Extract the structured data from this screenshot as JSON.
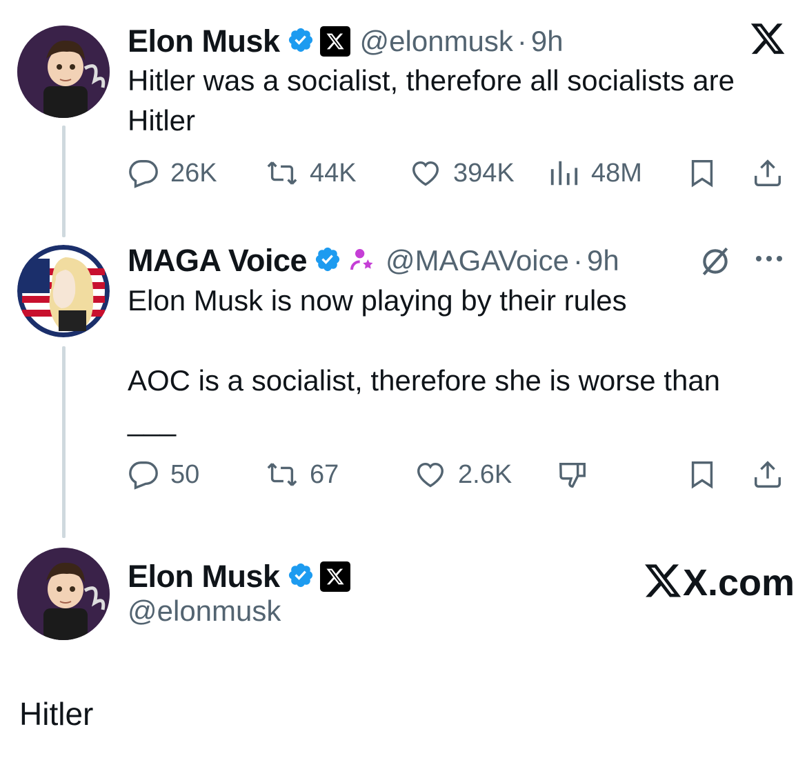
{
  "tweet1": {
    "name": "Elon Musk",
    "handle": "@elonmusk",
    "time": "9h",
    "text_line1": "Hitler was a socialist, therefore all socialists are",
    "text_line2": "Hitler",
    "replies": "26K",
    "retweets": "44K",
    "likes": "394K",
    "views": "48M",
    "icons": [
      "verified-badge-icon",
      "x-affiliate-icon",
      "x-logo-icon",
      "reply-icon",
      "retweet-icon",
      "like-icon",
      "views-icon",
      "bookmark-icon",
      "share-icon"
    ]
  },
  "tweet2": {
    "name": "MAGA Voice",
    "handle": "@MAGAVoice",
    "time": "9h",
    "text_line1": "Elon Musk is now playing by their rules",
    "text_line2": "AOC is a socialist, therefore she is worse than",
    "text_line3": "___",
    "replies": "50",
    "retweets": "67",
    "likes": "2.6K",
    "icons": [
      "verified-badge-icon",
      "subscriber-icon",
      "grok-icon",
      "more-icon",
      "reply-icon",
      "retweet-icon",
      "like-icon",
      "dislike-icon",
      "bookmark-icon",
      "share-icon"
    ]
  },
  "tweet3": {
    "name": "Elon Musk",
    "handle": "@elonmusk",
    "brand": "X.com",
    "text": "Hitler"
  },
  "colors": {
    "verified": "#1d9bf0",
    "secondary_text": "#536471",
    "thread_line": "#cfd9de",
    "subscriber_icon": "#c53ed6"
  }
}
